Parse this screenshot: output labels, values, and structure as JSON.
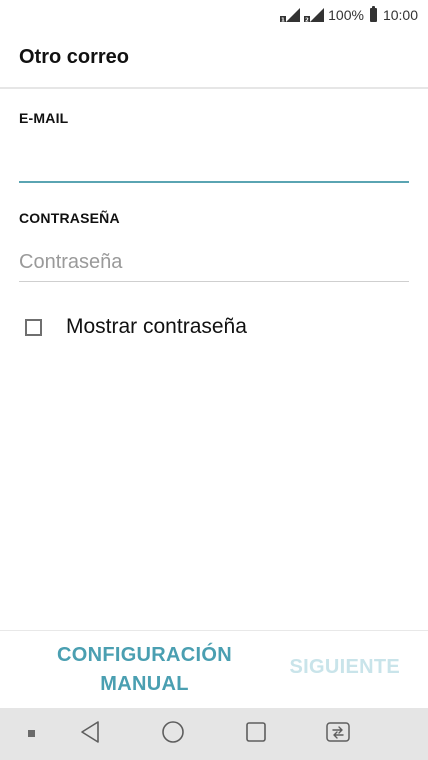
{
  "status_bar": {
    "battery_percent": "100%",
    "time": "10:00",
    "icons": [
      "signal-sim1-icon",
      "signal-sim2-icon",
      "battery-icon"
    ]
  },
  "app_bar": {
    "title": "Otro correo"
  },
  "form": {
    "email": {
      "label": "E-MAIL",
      "value": "",
      "placeholder": ""
    },
    "password": {
      "label": "CONTRASEÑA",
      "value": "",
      "placeholder": "Contraseña"
    },
    "show_password": {
      "label": "Mostrar contraseña",
      "checked": false
    }
  },
  "actions": {
    "manual_line1": "CONFIGURACIÓN",
    "manual_line2": "MANUAL",
    "next": "SIGUIENTE",
    "accent_color": "#4a9fb1",
    "disabled_color": "#c9e4ea"
  },
  "nav_bar": {
    "icons": [
      "dot-icon",
      "back-icon",
      "home-icon",
      "recents-icon",
      "dual-window-icon"
    ]
  }
}
